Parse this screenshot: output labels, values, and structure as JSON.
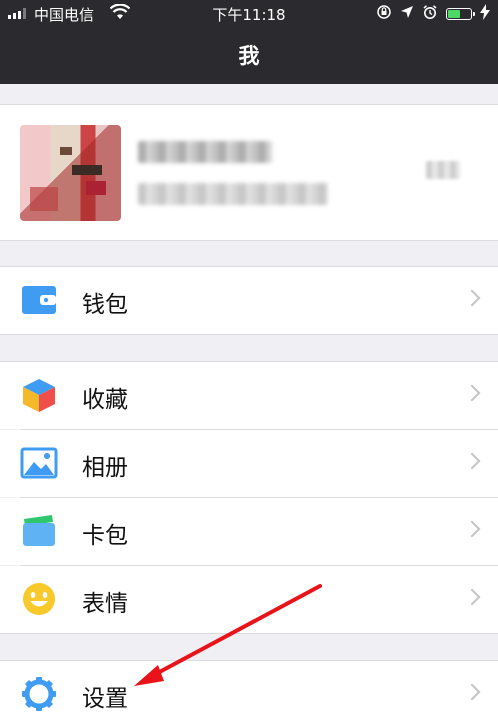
{
  "status_bar": {
    "carrier": "中国电信",
    "time": "下午11:18",
    "battery_level": 0.55,
    "battery_color": "#4cd964"
  },
  "header": {
    "title": "我"
  },
  "colors": {
    "header_bg": "#2b2b2f",
    "page_bg": "#efeff4",
    "icon_blue": "#3f9cf2",
    "annotation_red": "#e8141a"
  },
  "menu": {
    "wallet_label": "钱包",
    "favorites_label": "收藏",
    "album_label": "相册",
    "cards_label": "卡包",
    "stickers_label": "表情",
    "settings_label": "设置"
  },
  "icons": {
    "wallet": "wallet-icon",
    "favorites": "cube-icon",
    "album": "landscape-icon",
    "cards": "card-icon",
    "stickers": "smiley-icon",
    "settings": "gear-icon"
  }
}
